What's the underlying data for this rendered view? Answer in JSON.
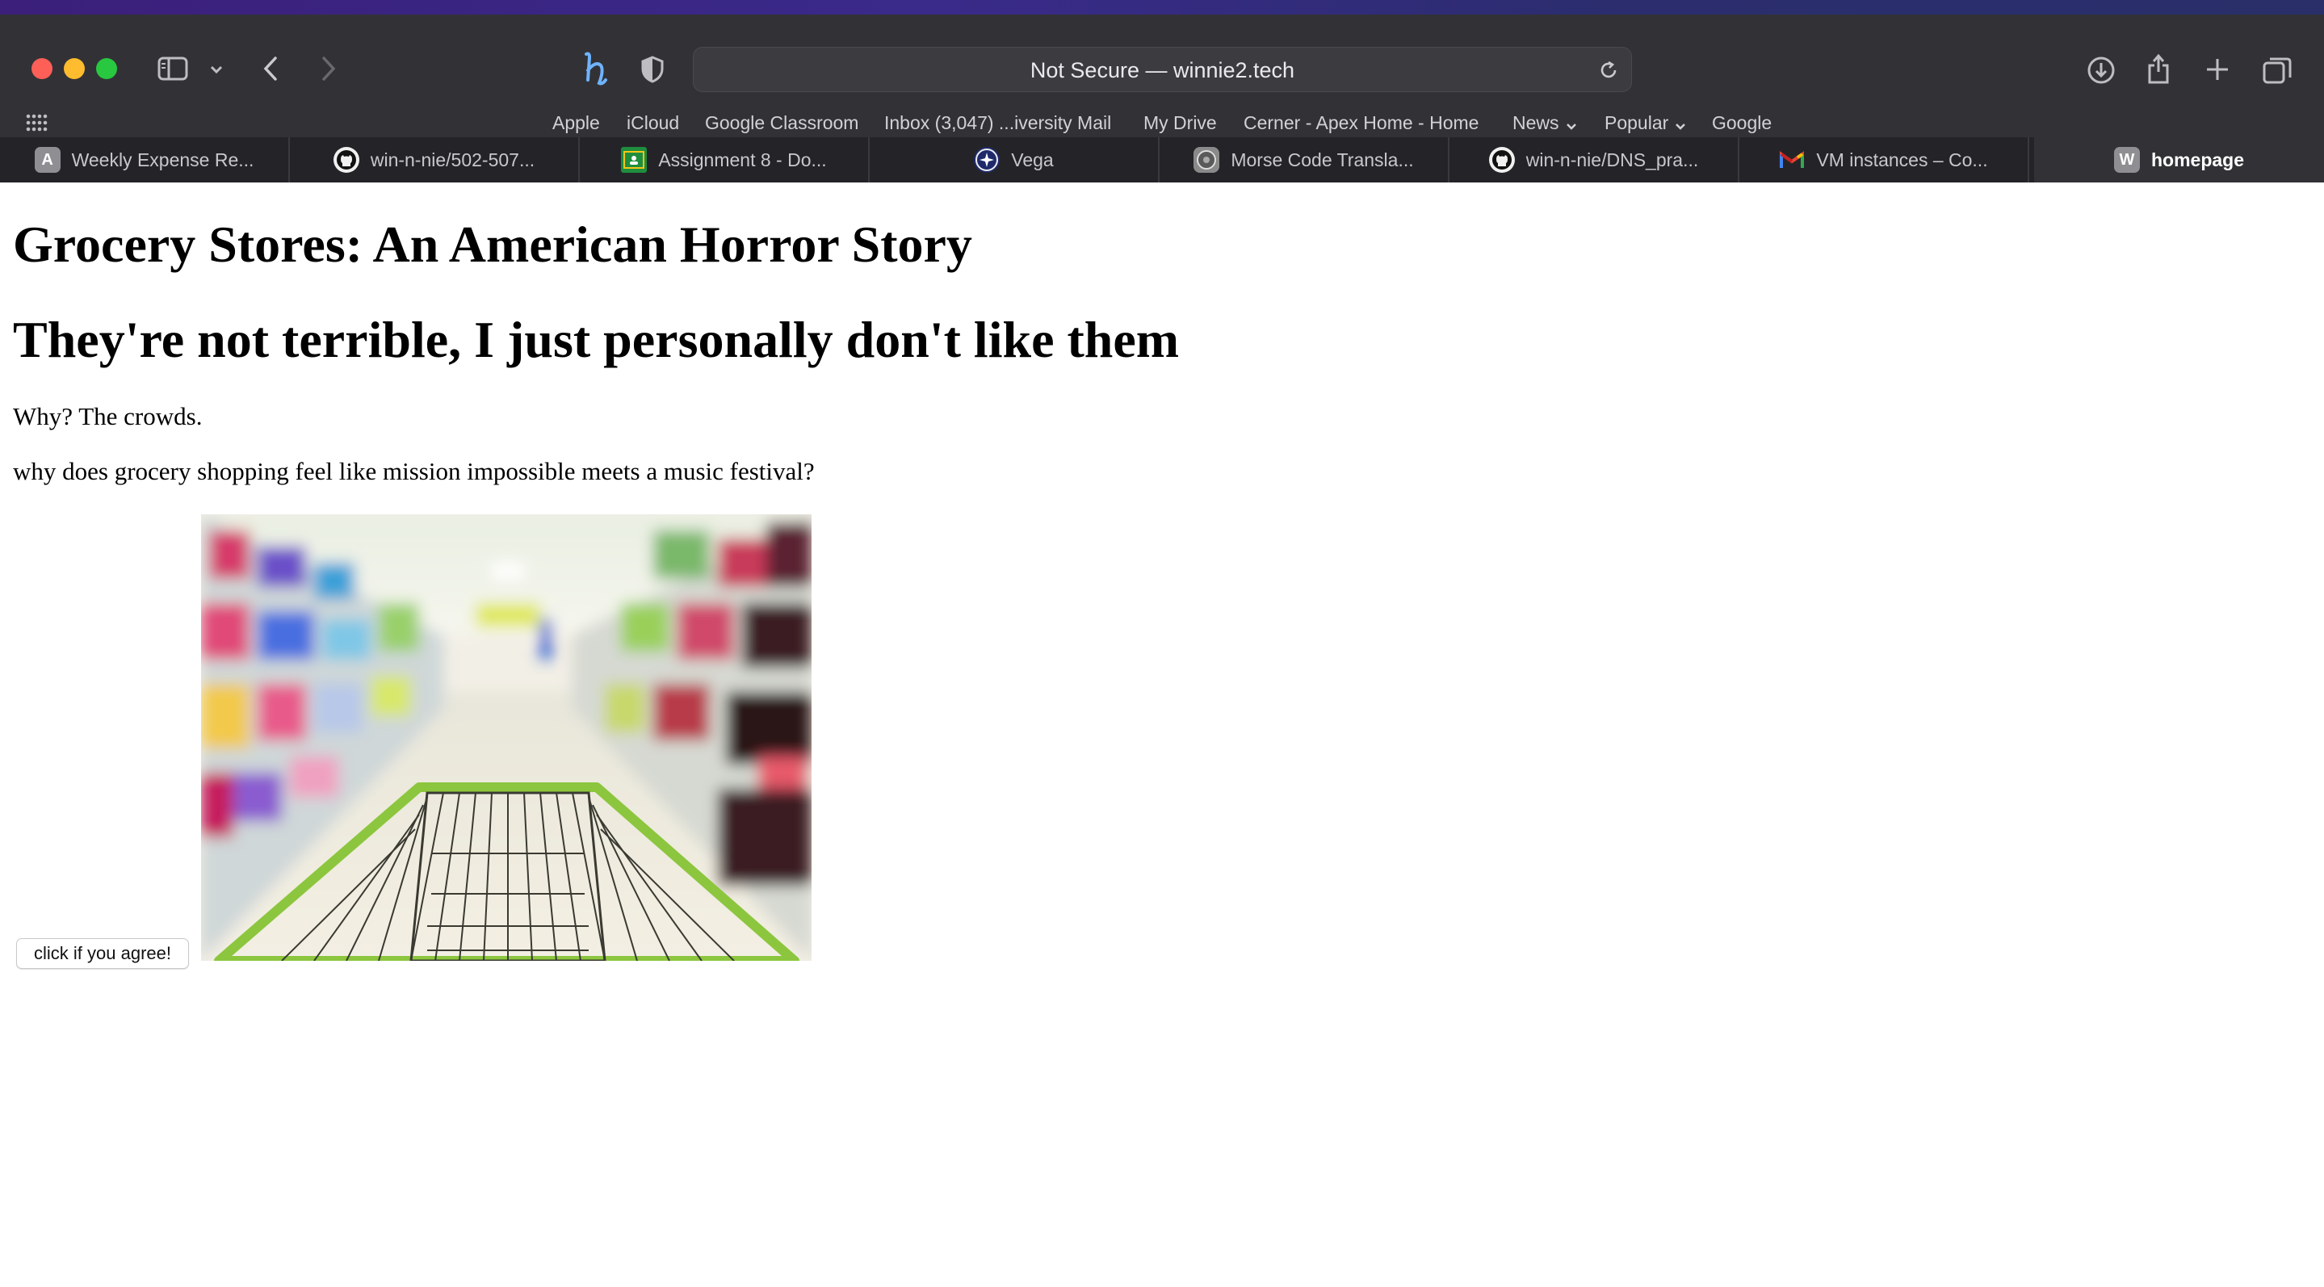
{
  "browser": {
    "address_bar": "Not Secure — winnie2.tech",
    "bookmarks": [
      "Apple",
      "iCloud",
      "Google Classroom",
      "Inbox (3,047) ...iversity Mail",
      "My Drive",
      "Cerner - Apex Home - Home",
      "News",
      "Popular",
      "Google"
    ],
    "tabs": [
      {
        "label": "Weekly Expense Re...",
        "icon": "a-app-icon",
        "fav_text": "A",
        "color": "#8e8e93"
      },
      {
        "label": "win-n-nie/502-507...",
        "icon": "github-icon",
        "color": "#f0f0f0"
      },
      {
        "label": "Assignment 8 - Do...",
        "icon": "google-classroom-icon",
        "color": "#1e8e3e"
      },
      {
        "label": "Vega",
        "icon": "vega-icon",
        "color": "#1f2a6b"
      },
      {
        "label": "Morse Code Transla...",
        "icon": "morse-icon",
        "color": "#8a8a8a"
      },
      {
        "label": "win-n-nie/DNS_pra...",
        "icon": "github-icon",
        "color": "#f0f0f0"
      },
      {
        "label": "VM instances – Co...",
        "icon": "gmail-icon",
        "color": "#ea4335"
      },
      {
        "label": "homepage",
        "icon": "w-app-icon",
        "fav_text": "W",
        "color": "#8e8e93",
        "active": true
      }
    ]
  },
  "page": {
    "heading1": "Grocery Stores: An American Horror Story",
    "heading2": "They're not terrible, I just personally don't like them",
    "paragraph1": "Why? The crowds.",
    "paragraph2": "why does grocery shopping feel like mission impossible meets a music festival?",
    "button_label": "click if you agree!",
    "image_subject": "grocery-aisle-shopping-cart-photo"
  }
}
